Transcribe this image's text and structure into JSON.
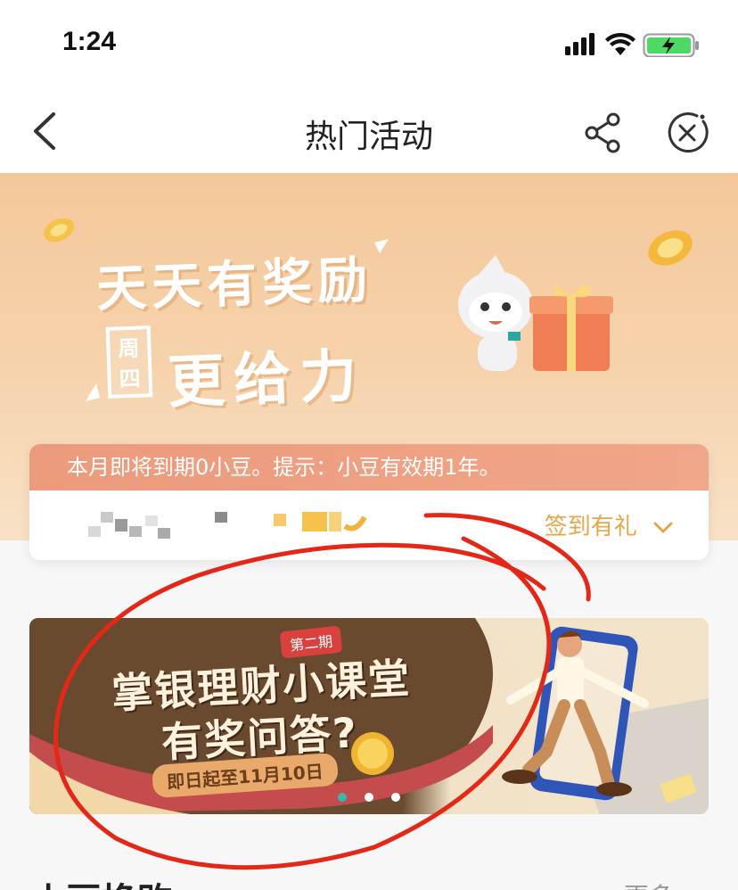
{
  "status": {
    "time": "1:24"
  },
  "nav": {
    "title": "热门活动"
  },
  "banner": {
    "slogan_line1": "天天有奖励",
    "weekday": "周四",
    "slogan_line2": "更给力"
  },
  "notice": {
    "text": "本月即将到期0小豆。提示：小豆有效期1年。",
    "signin_label": "签到有礼"
  },
  "promo": {
    "tag": "第二期",
    "title": "掌银理财小课堂",
    "subtitle": "有奖问答?",
    "date": "即日起至11月10日",
    "dots": 3,
    "active_dot": 0
  },
  "section": {
    "title": "小豆换购",
    "more": "更多 >"
  },
  "colors": {
    "accent": "#e7a64a",
    "notice_strip": "#ec9a7c",
    "annotation": "#e42818",
    "dot_active": "#3cb7a6"
  }
}
